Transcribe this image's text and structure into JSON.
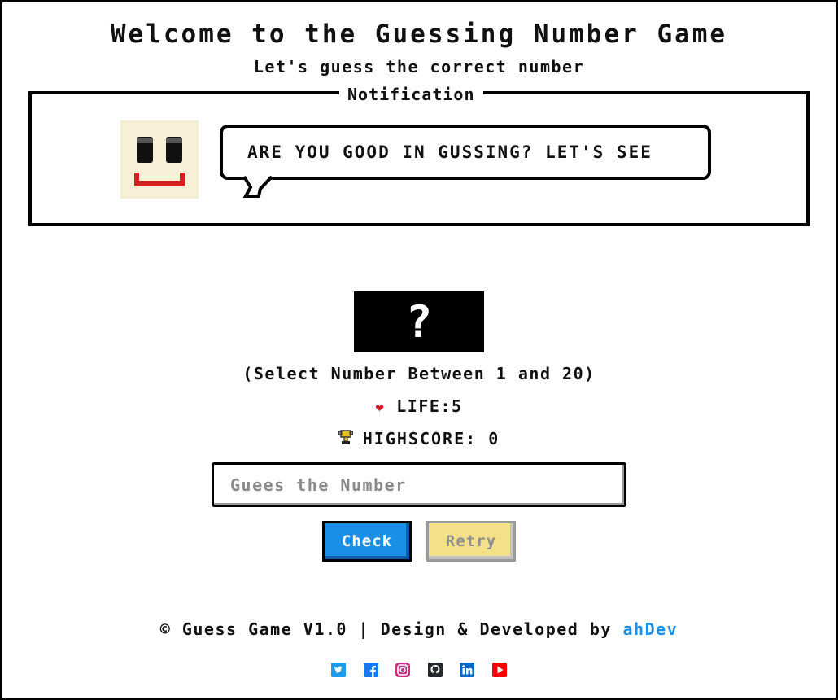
{
  "header": {
    "title": "Welcome to the Guessing Number Game",
    "subtitle": "Let's guess the correct number"
  },
  "notification": {
    "legend": "Notification",
    "message": "ARE YOU GOOD IN GUSSING? LET'S SEE",
    "avatar_icon": "smiley-face-icon"
  },
  "game": {
    "mystery_symbol": "?",
    "range_text": "(Select Number Between 1 and 20)",
    "life_label": "LIFE:5",
    "highscore_label": "HIGHSCORE: 0",
    "input": {
      "placeholder": "Guees the Number",
      "value": ""
    },
    "check_label": "Check",
    "retry_label": "Retry"
  },
  "footer": {
    "text": "© Guess Game V1.0 | Design & Developed by ",
    "author_link": "ahDev",
    "social_icons": [
      "twitter-icon",
      "facebook-icon",
      "instagram-icon",
      "github-icon",
      "linkedin-icon",
      "youtube-icon"
    ]
  },
  "colors": {
    "check_button": "#1b8fe6",
    "retry_button": "#f5e08a",
    "heart": "#d41b25",
    "link": "#1b8fe6",
    "trophy": "#e8c21c"
  }
}
